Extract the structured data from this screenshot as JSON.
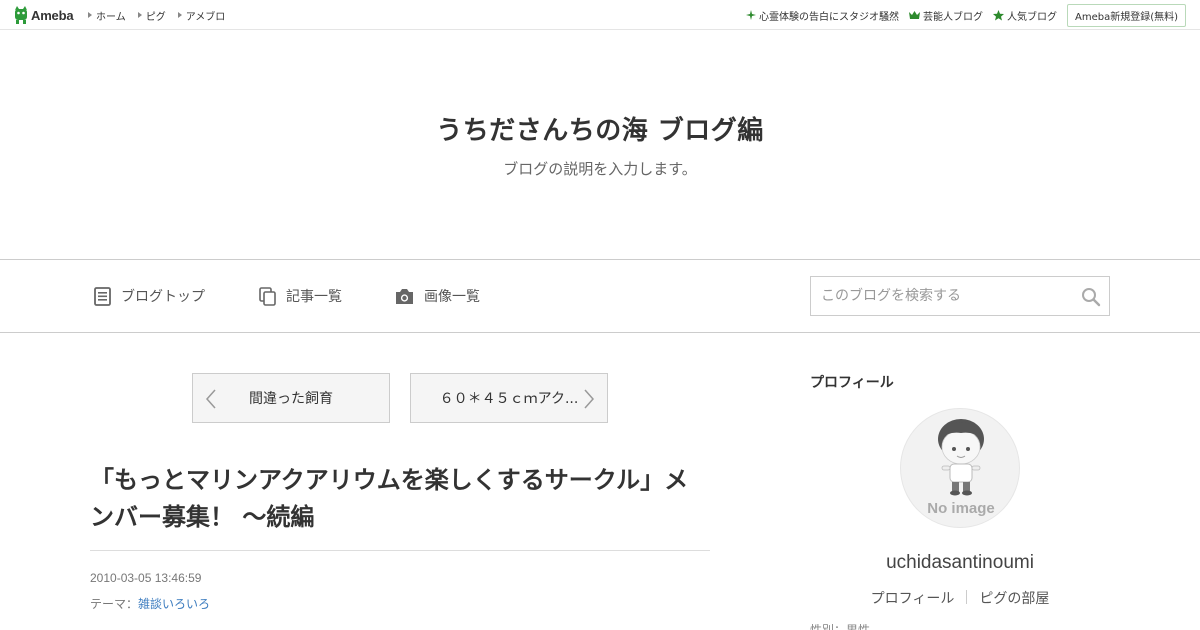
{
  "global_bar": {
    "logo_text": "Ameba",
    "nav": [
      "ホーム",
      "ピグ",
      "アメブロ"
    ],
    "right_links": [
      {
        "label": "心霊体験の告白にスタジオ騒然",
        "icon": "sparkle-icon"
      },
      {
        "label": "芸能人ブログ",
        "icon": "crown-icon"
      },
      {
        "label": "人気ブログ",
        "icon": "star-icon"
      }
    ],
    "register_label": "Ameba新規登録(無料)",
    "accent_color": "#2d8a2d"
  },
  "header": {
    "title": "うちださんちの海 ブログ編",
    "description": "ブログの説明を入力します。"
  },
  "blog_nav": {
    "items": [
      {
        "label": "ブログトップ",
        "icon": "document-icon"
      },
      {
        "label": "記事一覧",
        "icon": "copy-icon"
      },
      {
        "label": "画像一覧",
        "icon": "camera-icon"
      }
    ],
    "search_placeholder": "このブログを検索する"
  },
  "pager": {
    "prev_label": "間違った飼育",
    "next_label": "６０＊４５ｃｍアク..."
  },
  "article": {
    "title": "「もっとマリンアクアリウムを楽しくするサークル」メンバー募集！ ～続編",
    "date": "2010-03-05 13:46:59",
    "theme_prefix": "テーマ：",
    "theme_link": "雑談いろいろ",
    "link_color": "#3c7cbf"
  },
  "sidebar": {
    "heading": "プロフィール",
    "avatar_text": "No image",
    "username": "uchidasantinoumi",
    "links": [
      "プロフィール",
      "ピグの部屋"
    ],
    "cut_text": "性別：男性"
  }
}
